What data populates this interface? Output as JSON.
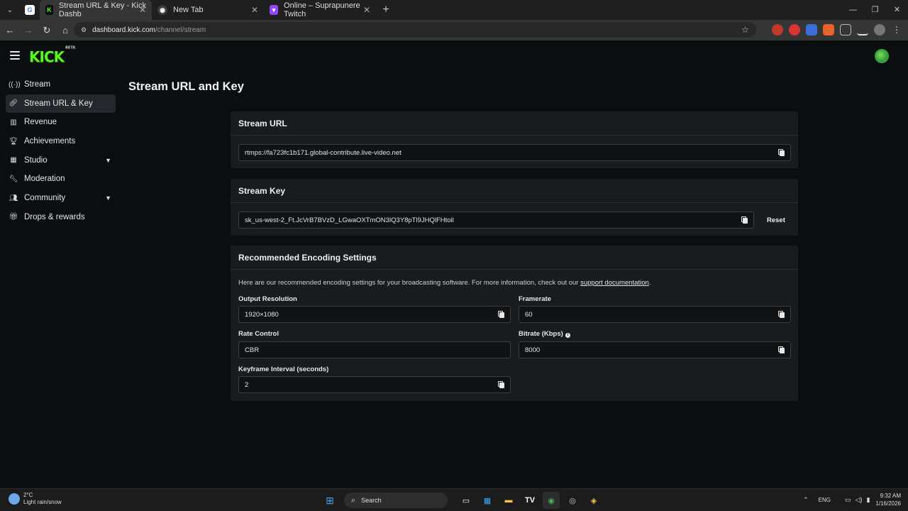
{
  "browser": {
    "tabs": [
      {
        "title": "Stream URL & Key - Kick Dashb",
        "favicon": "kick-icon",
        "active": true
      },
      {
        "title": "New Tab",
        "favicon": "chrome-icon",
        "active": false
      },
      {
        "title": "Online – Suprapunere Twitch",
        "favicon": "twitch-icon",
        "active": false
      }
    ],
    "url_host": "dashboard.kick.com",
    "url_path": "/channel/stream"
  },
  "app": {
    "logo": "KICK",
    "logo_badge": "BETA"
  },
  "sidebar": {
    "items": [
      {
        "label": "Stream",
        "icon": "broadcast-icon"
      },
      {
        "label": "Stream URL & Key",
        "icon": "link-icon"
      },
      {
        "label": "Revenue",
        "icon": "chart-icon"
      },
      {
        "label": "Achievements",
        "icon": "trophy-icon"
      },
      {
        "label": "Studio",
        "icon": "grid-icon"
      },
      {
        "label": "Moderation",
        "icon": "wrench-icon"
      },
      {
        "label": "Community",
        "icon": "users-icon"
      },
      {
        "label": "Drops & rewards",
        "icon": "gift-icon"
      }
    ]
  },
  "main": {
    "title": "Stream URL and Key",
    "stream_url": {
      "heading": "Stream URL",
      "value": "rtmps://fa723fc1b171.global-contribute.live-video.net"
    },
    "stream_key": {
      "heading": "Stream Key",
      "value": "sk_us-west-2_Ft.JcVrB7BVzD_LGwaOXTmON3lQ3Y8pTl9JHQlFHtoil",
      "reset_label": "Reset"
    },
    "encoding": {
      "heading": "Recommended Encoding Settings",
      "description": "Here are our recommended encoding settings for your broadcasting software. For more information, check out our",
      "link": "support documentation",
      "output_resolution_label": "Output Resolution",
      "output_resolution": "1920×1080",
      "framerate_label": "Framerate",
      "framerate": "60",
      "rate_control_label": "Rate Control",
      "rate_control": "CBR",
      "bitrate_label": "Bitrate (Kbps)",
      "bitrate": "8000",
      "keyframe_label": "Keyframe Interval (seconds)",
      "keyframe": "2"
    }
  },
  "taskbar": {
    "weather_temp": "2°C",
    "weather_desc": "Light rain/snow",
    "search_label": "Search",
    "lang": "ENG",
    "time": "9:32 AM",
    "date": "1/16/2026"
  },
  "colors": {
    "brand": "#53fc18",
    "background": "#0b0e0f",
    "card": "#191b1f"
  }
}
